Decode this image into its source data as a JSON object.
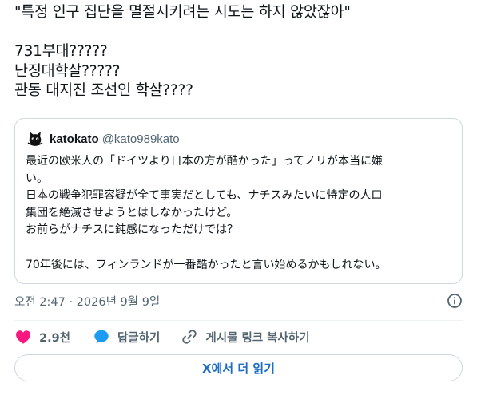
{
  "tweet": {
    "lines": [
      "\"특정 인구 집단을 멸절시키려는 시도는 하지 않았잖아\"",
      "",
      "731부대?????",
      "난징대학살?????",
      "관동 대지진 조선인 학살????"
    ]
  },
  "quote": {
    "display_name": "katokato",
    "handle": "@kato989kato",
    "avatar_icon": "black-cat-avatar-icon",
    "lines": [
      "最近の欧米人の「ドイツより日本の方が酷かった」ってノリが本当に嫌",
      "い。",
      "日本の戦争犯罪容疑が全て事実だとしても、ナチスみたいに特定の人口",
      "集団を絶滅させようとはしなかったけど。",
      "お前らがナチスに鈍感になっただけでは？",
      "",
      "70年後には、フィンランドが一番酷かったと言い始めるかもしれない。"
    ]
  },
  "meta": {
    "timestamp": "오전 2:47 · 2026년 9월 9일",
    "info_icon": "info-circle-icon"
  },
  "actions": {
    "like_count": "2.9천",
    "like_icon": "heart-icon",
    "like_color": "#f91880",
    "reply_label": "답글하기",
    "reply_icon": "speech-bubble-icon",
    "reply_color": "#1d9bf0",
    "copy_link_label": "게시물 링크 복사하기",
    "copy_link_icon": "link-icon"
  },
  "read_more": {
    "label": "X에서 더 읽기"
  },
  "colors": {
    "text_primary": "#0f1419",
    "text_secondary": "#536471",
    "border": "#cfd9de",
    "link_blue": "#1d6ec2"
  }
}
